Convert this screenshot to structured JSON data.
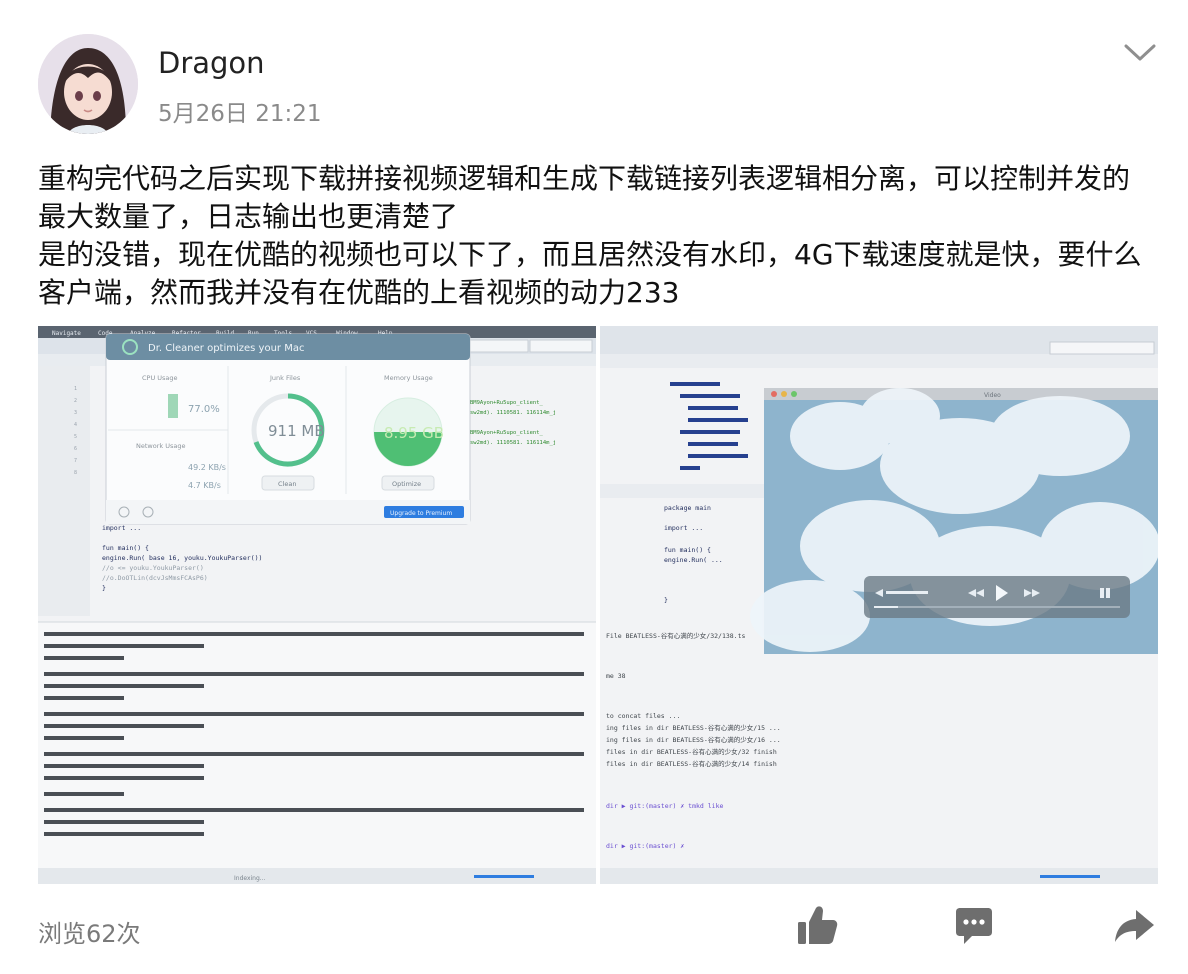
{
  "post": {
    "author": "Dragon",
    "time": "5月26日 21:21",
    "content_lines": [
      "重构完代码之后实现下载拼接视频逻辑和生成下载链接列表逻辑相分离，可以控制并发的最大数量了，日志输出也更清楚了",
      "是的没错，现在优酷的视频也可以下了，而且居然没有水印，4G下载速度就是快，要什么客户端，然而我并没有在优酷的上看视频的动力233"
    ],
    "views": "浏览62次"
  },
  "screenshot_left": {
    "menu_items": [
      "Navigate",
      "Code",
      "Analyze",
      "Refactor",
      "Build",
      "Run",
      "Tools",
      "VCS",
      "Window",
      "Help"
    ],
    "cleaner": {
      "title": "Dr. Cleaner optimizes your Mac",
      "cpu_label": "CPU Usage",
      "cpu_value": "77.0%",
      "junk_label": "Junk Files",
      "junk_value": "911 MB",
      "junk_button": "Clean",
      "memory_label": "Memory Usage",
      "memory_value": "8.95 GB",
      "memory_button": "Optimize",
      "network_label": "Network Usage",
      "network_up": "49.2 KB/s",
      "network_down": "4.7 KB/s",
      "upgrade_button": "Upgrade to Premium"
    },
    "code_lines": [
      "import ...",
      "fun main() {",
      "    engine.Run( base 16, youku.YoukuParser())",
      "    //o <= youku.YoukuParser()",
      "    //o.DoOTLin(dcvJsMmsFCAsP6)",
      "}"
    ],
    "status_text": "Indexing..."
  },
  "screenshot_right": {
    "code_lines": [
      "package main",
      "import ...",
      "fun main() {",
      "    engine.Run( ...",
      "}"
    ],
    "player_window_title": "Video",
    "terminal_lines": [
      "File BEATLESS-谷有心满的少女/32/138.ts",
      "me 38",
      "to concat files ...",
      "ing files in dir BEATLESS-谷有心满的少女/15 ...",
      "ing files in dir BEATLESS-谷有心满的少女/16 ...",
      "files in dir BEATLESS-谷有心满的少女/32 finish",
      "files in dir BEATLESS-谷有心满的少女/14 finish",
      "dir ▶ git:(master) ✗ tmkd  like",
      "dir ▶ git:(master) ✗"
    ]
  },
  "icons": {
    "menu": "chevron-down-icon",
    "like": "thumbs-up-icon",
    "comment": "comment-bubble-icon",
    "share": "share-arrow-icon"
  },
  "colors": {
    "text": "#111111",
    "meta": "#8a8a8a",
    "icon": "#6e6e6e"
  }
}
